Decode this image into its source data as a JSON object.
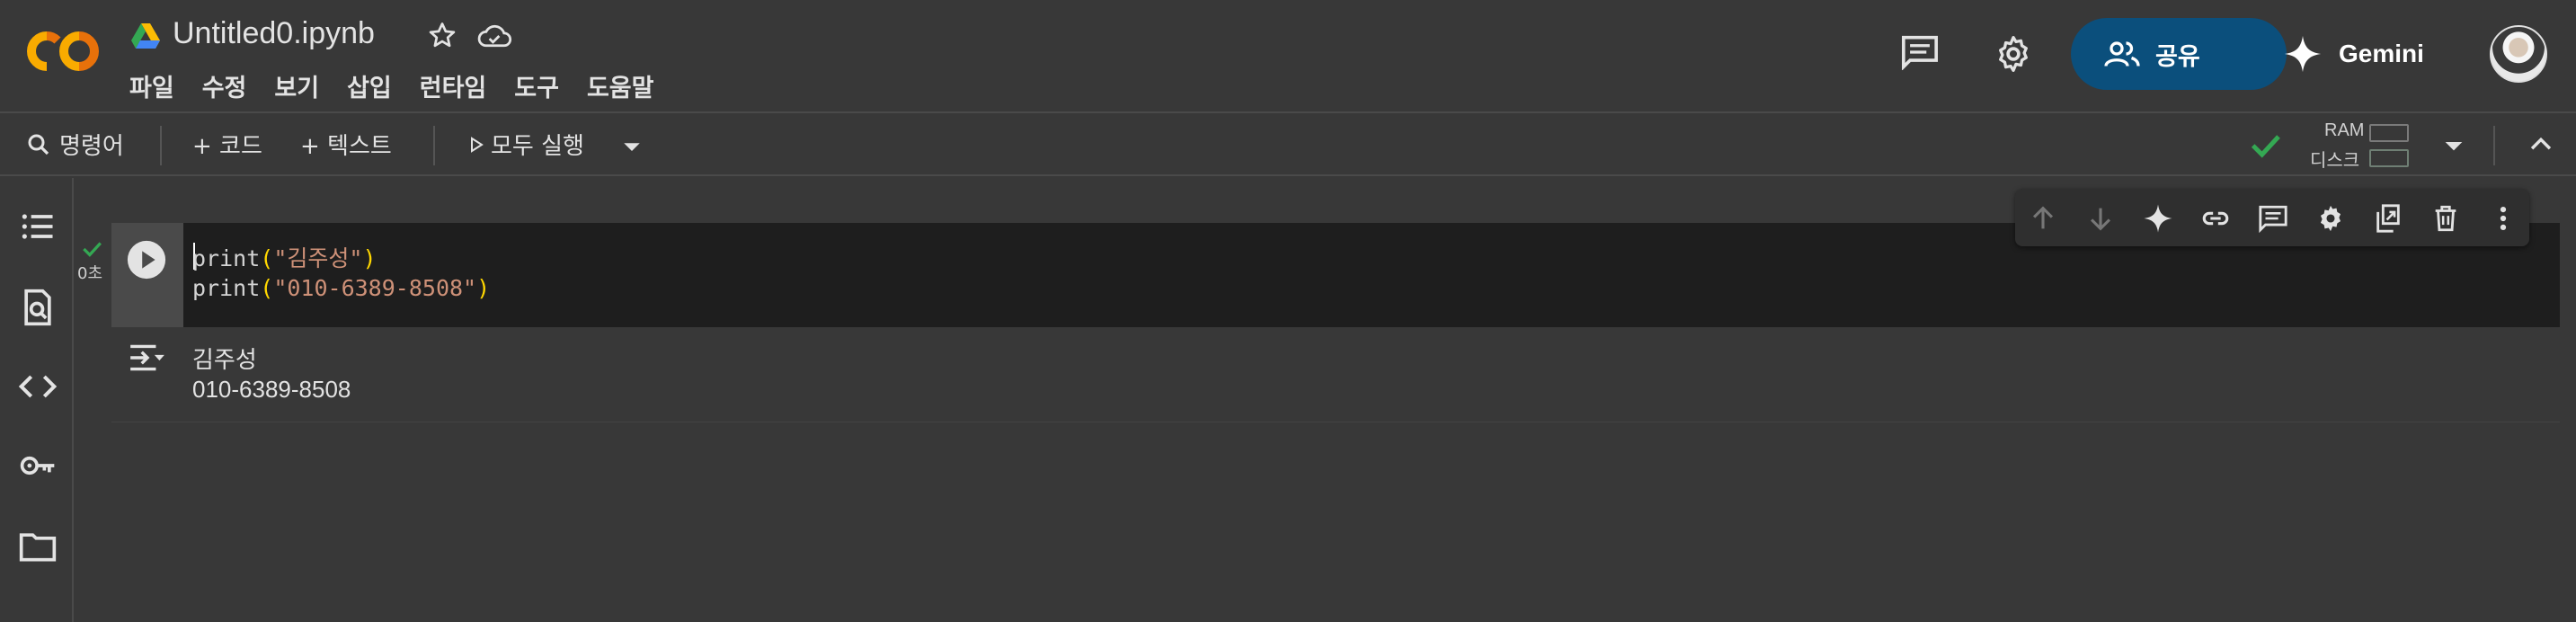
{
  "app": {
    "file_name": "Untitled0.ipynb",
    "menu": [
      "파일",
      "수정",
      "보기",
      "삽입",
      "런타임",
      "도구",
      "도움말"
    ],
    "share_label": "공유",
    "gemini_label": "Gemini"
  },
  "toolbar": {
    "commands_label": "명령어",
    "add_code_label": "+ 코드",
    "add_text_label": "+ 텍스트",
    "run_all_label": "모두 실행",
    "ram_label": "RAM",
    "disk_label": "디스크"
  },
  "cell": {
    "exec_time": "0초",
    "code": [
      {
        "fn": "print",
        "open": "(",
        "str": "\"김주성\"",
        "close": ")"
      },
      {
        "fn": "print",
        "open": "(",
        "str": "\"010-6389-8508\"",
        "close": ")"
      }
    ],
    "output": [
      "김주성",
      "010-6389-8508"
    ]
  },
  "colors": {
    "background": "#383838",
    "cell_bg": "#1e1e1e",
    "share_btn": "#0b4f7c",
    "string": "#ce9178",
    "paren": "#ffd700",
    "success": "#34a853"
  },
  "icons": {
    "sidebar": [
      "table-of-contents-icon",
      "find-replace-icon",
      "code-snippets-icon",
      "secrets-key-icon",
      "files-folder-icon"
    ],
    "cell_toolbar": [
      "move-up-icon",
      "move-down-icon",
      "gemini-icon",
      "link-icon",
      "comment-icon",
      "settings-icon",
      "mirror-cell-icon",
      "delete-icon",
      "more-vert-icon"
    ]
  }
}
